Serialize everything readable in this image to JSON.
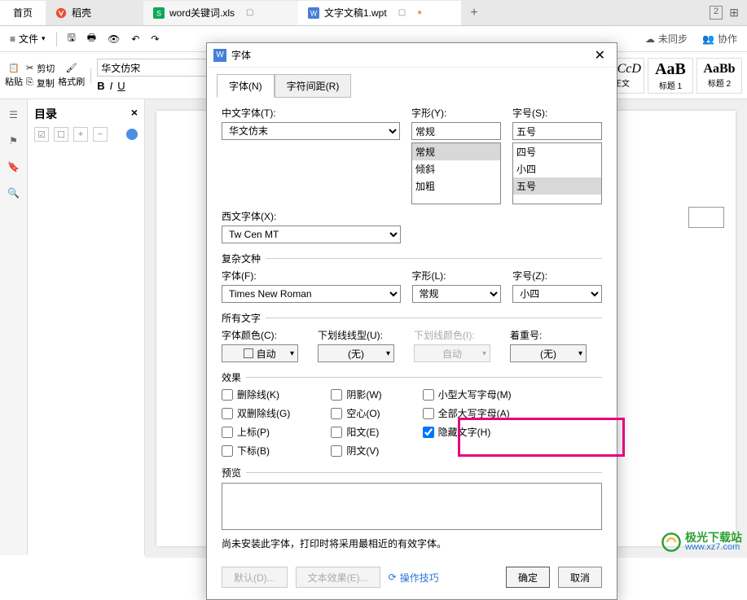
{
  "tabs": {
    "home": "首页",
    "docer": "稻壳",
    "xls": "word关键词.xls",
    "active": "文字文稿1.wpt"
  },
  "toolbar": {
    "file": "文件"
  },
  "sync": {
    "unsynced": "未同步",
    "collab": "协作"
  },
  "ribbon": {
    "paste": "粘贴",
    "cut": "剪切",
    "copy": "复制",
    "format_painter": "格式刷",
    "font_name": "华文仿宋"
  },
  "styles": {
    "s1": {
      "preview": "ƁbCcD",
      "label": "正文"
    },
    "s2": {
      "preview": "AaB",
      "label": "标题 1"
    },
    "s3": {
      "preview": "AaBb",
      "label": "标题 2"
    }
  },
  "nav": {
    "title": "目录"
  },
  "dialog": {
    "title": "字体",
    "tab_font": "字体(N)",
    "tab_spacing": "字符间距(R)",
    "cn_font_label": "中文字体(T):",
    "cn_font_value": "华文仿末",
    "style_label": "字形(Y):",
    "style_value": "常规",
    "style_opts": [
      "常规",
      "倾斜",
      "加粗"
    ],
    "size_label": "字号(S):",
    "size_value": "五号",
    "size_opts": [
      "四号",
      "小四",
      "五号"
    ],
    "en_font_label": "西文字体(X):",
    "en_font_value": "Tw Cen MT",
    "complex_label": "复杂文种",
    "c_font_label": "字体(F):",
    "c_font_value": "Times New Roman",
    "c_style_label": "字形(L):",
    "c_style_value": "常规",
    "c_size_label": "字号(Z):",
    "c_size_value": "小四",
    "all_label": "所有文字",
    "font_color_label": "字体颜色(C):",
    "font_color_value": "自动",
    "underline_label": "下划线线型(U):",
    "underline_value": "(无)",
    "ul_color_label": "下划线颜色(I):",
    "ul_color_value": "自动",
    "emphasis_label": "着重号:",
    "emphasis_value": "(无)",
    "effects_label": "效果",
    "fx": {
      "strike": "删除线(K)",
      "dbl_strike": "双删除线(G)",
      "sup": "上标(P)",
      "sub": "下标(B)",
      "shadow": "阴影(W)",
      "outline": "空心(O)",
      "emboss": "阳文(E)",
      "engrave": "阴文(V)",
      "small_caps": "小型大写字母(M)",
      "all_caps": "全部大写字母(A)",
      "hidden": "隐藏文字(H)"
    },
    "preview_label": "预览",
    "note": "尚未安装此字体，打印时将采用最相近的有效字体。",
    "btn_default": "默认(D)...",
    "btn_text_fx": "文本效果(E)...",
    "btn_tips": "操作技巧",
    "btn_ok": "确定",
    "btn_cancel": "取消"
  },
  "watermark": {
    "cn": "极光下载站",
    "url": "www.xz7.com"
  }
}
